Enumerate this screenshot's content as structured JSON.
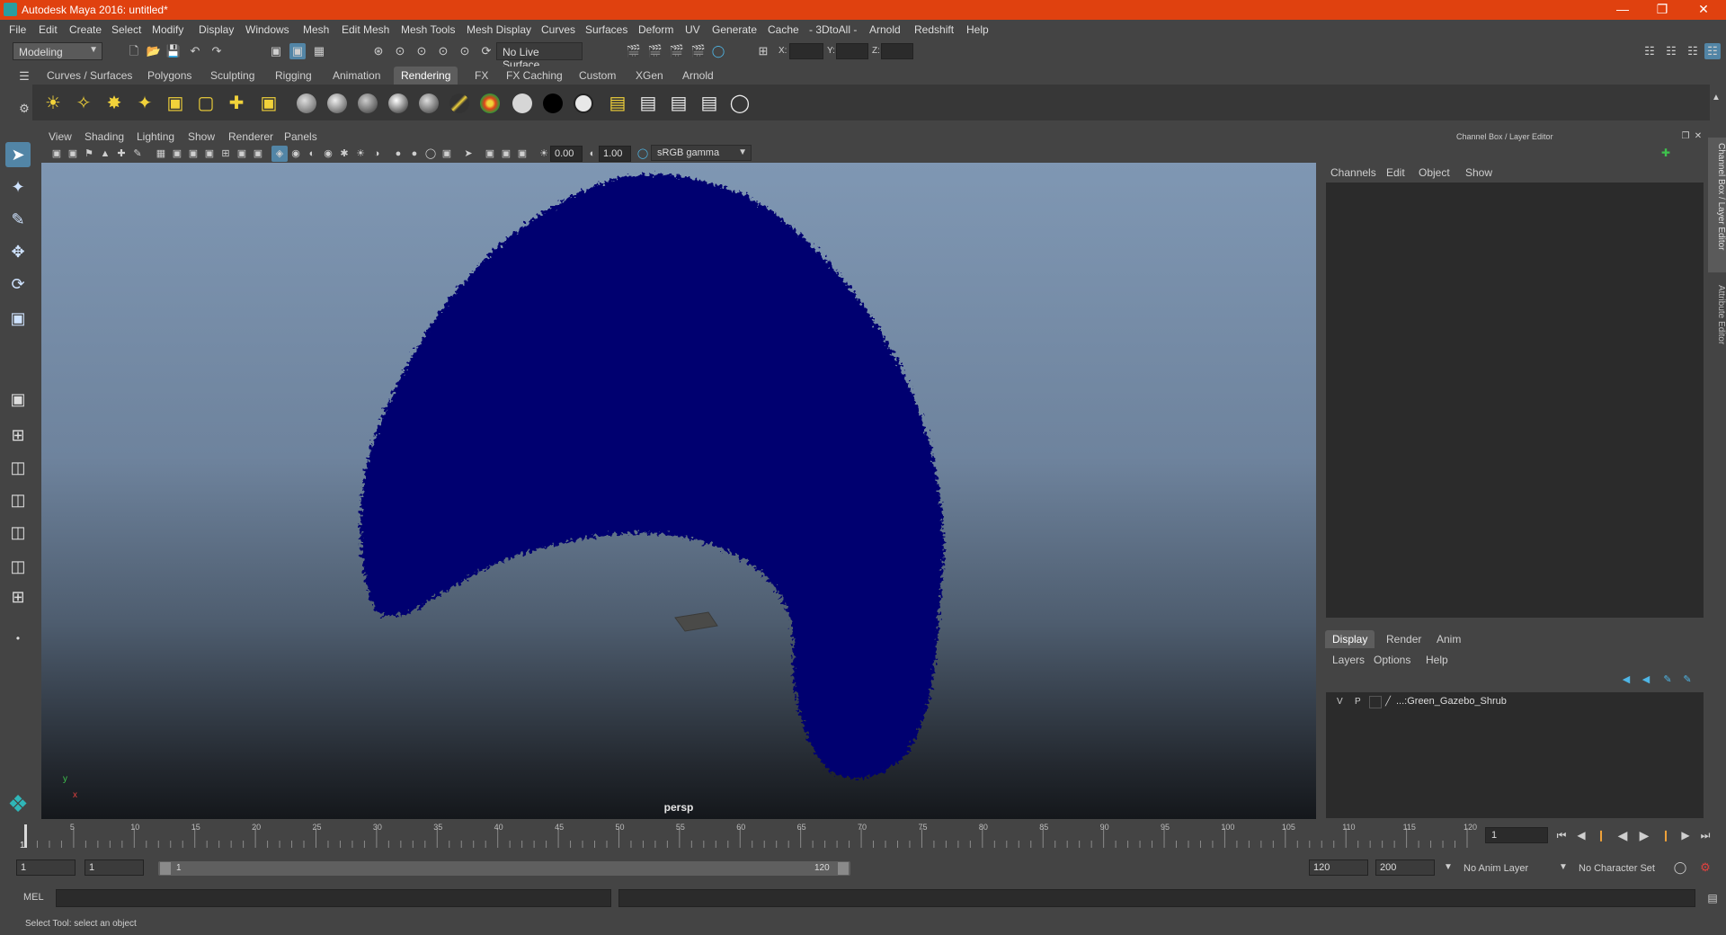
{
  "window": {
    "title": "Autodesk Maya 2016: untitled*"
  },
  "menubar": [
    "File",
    "Edit",
    "Create",
    "Select",
    "Modify",
    "Display",
    "Windows",
    "Mesh",
    "Edit Mesh",
    "Mesh Tools",
    "Mesh Display",
    "Curves",
    "Surfaces",
    "Deform",
    "UV",
    "Generate",
    "Cache",
    "- 3DtoAll -",
    "Arnold",
    "Redshift",
    "Help"
  ],
  "statusline": {
    "menuset": "Modeling",
    "live_surface": "No Live Surface",
    "x_label": "X:",
    "y_label": "Y:",
    "z_label": "Z:"
  },
  "shelf_tabs": [
    "Curves / Surfaces",
    "Polygons",
    "Sculpting",
    "Rigging",
    "Animation",
    "Rendering",
    "FX",
    "FX Caching",
    "Custom",
    "XGen",
    "Arnold"
  ],
  "shelf_active_tab": "Rendering",
  "viewport": {
    "menu": [
      "View",
      "Shading",
      "Lighting",
      "Show",
      "Renderer",
      "Panels"
    ],
    "exposure": "0.00",
    "gamma": "1.00",
    "color_space": "sRGB gamma",
    "camera_label": "persp",
    "axis_x": "x",
    "axis_y": "y"
  },
  "channel_box": {
    "title": "Channel Box / Layer Editor",
    "menu": [
      "Channels",
      "Edit",
      "Object",
      "Show"
    ],
    "side_tab_1": "Channel Box / Layer Editor",
    "side_tab_2": "Attribute Editor"
  },
  "layer_editor": {
    "tabs": [
      "Display",
      "Render",
      "Anim"
    ],
    "active_tab": "Display",
    "menu": [
      "Layers",
      "Options",
      "Help"
    ],
    "layer": {
      "v": "V",
      "p": "P",
      "name": "...:Green_Gazebo_Shrub"
    }
  },
  "timeslider": {
    "ticks": [
      "5",
      "10",
      "15",
      "20",
      "25",
      "30",
      "35",
      "40",
      "45",
      "50",
      "55",
      "60",
      "65",
      "70",
      "75",
      "80",
      "85",
      "90",
      "95",
      "100",
      "105",
      "110",
      "115",
      "120"
    ],
    "current_marker": "1",
    "current_frame": "1"
  },
  "range": {
    "start": "1",
    "playback_start": "1",
    "slider_start": "1",
    "slider_end": "120",
    "playback_end": "120",
    "end": "200",
    "anim_layer": "No Anim Layer",
    "character_set": "No Character Set"
  },
  "cmdline": {
    "label": "MEL"
  },
  "helpline": {
    "text": "Select Tool: select an object"
  },
  "colors": {
    "titlebar": "#e0410f",
    "shrub": "#040470",
    "active_tool": "#5285a6"
  }
}
